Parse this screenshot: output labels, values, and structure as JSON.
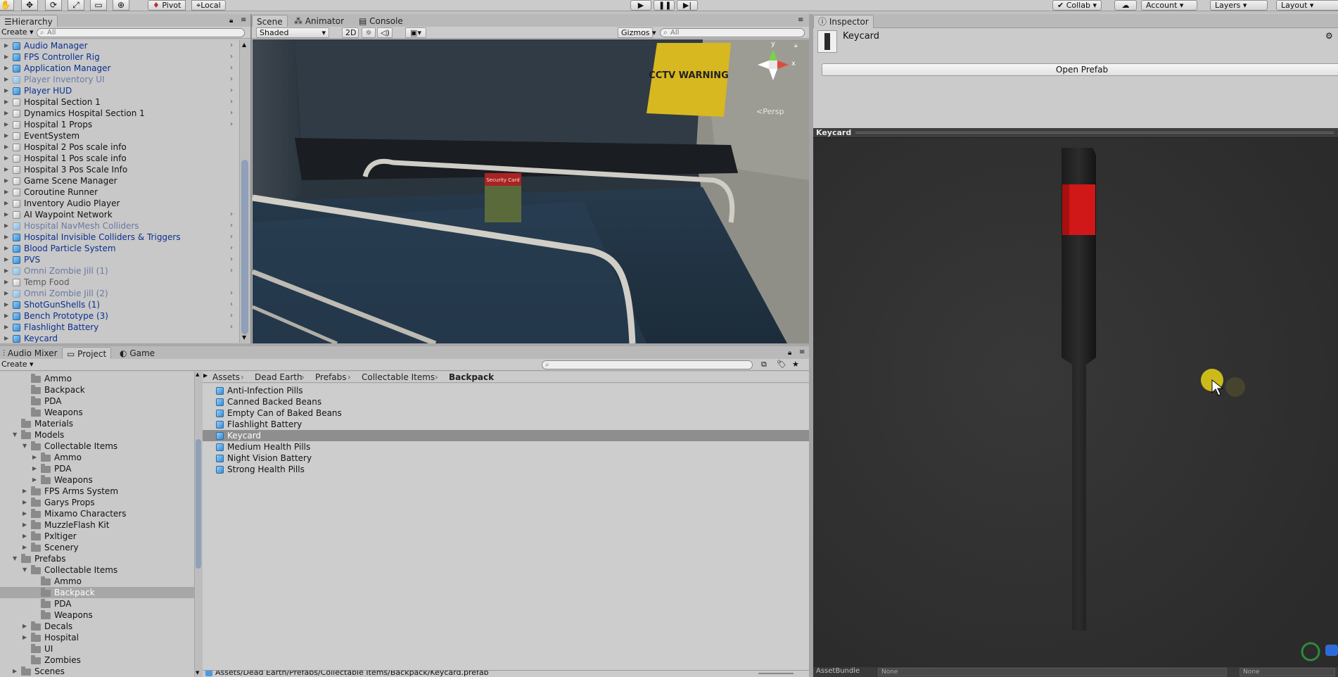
{
  "toolbar": {
    "pivot_label": "Pivot",
    "local_label": "Local",
    "collab_label": "Collab",
    "account_label": "Account",
    "layers_label": "Layers",
    "layout_label": "Layout"
  },
  "hierarchy": {
    "tab_label": "Hierarchy",
    "create_label": "Create",
    "search_placeholder": "All",
    "items": [
      {
        "label": "Audio Manager",
        "type": "prefab",
        "expand": true
      },
      {
        "label": "FPS Controller Rig",
        "type": "prefab",
        "expand": true
      },
      {
        "label": "Application Manager",
        "type": "prefab",
        "expand": true
      },
      {
        "label": "Player Inventory UI",
        "type": "off",
        "expand": true
      },
      {
        "label": "Player HUD",
        "type": "prefab",
        "expand": true
      },
      {
        "label": "Hospital Section 1",
        "type": "go",
        "expand": true
      },
      {
        "label": "Dynamics Hospital Section 1",
        "type": "go",
        "expand": true
      },
      {
        "label": "Hospital 1 Props",
        "type": "go",
        "expand": true
      },
      {
        "label": "EventSystem",
        "type": "go",
        "expand": false
      },
      {
        "label": "Hospital 2 Pos scale info",
        "type": "go",
        "expand": false
      },
      {
        "label": "Hospital 1 Pos scale info",
        "type": "go",
        "expand": false
      },
      {
        "label": "Hospital 3 Pos Scale Info",
        "type": "go",
        "expand": false
      },
      {
        "label": "Game Scene Manager",
        "type": "go",
        "expand": false
      },
      {
        "label": "Coroutine Runner",
        "type": "go",
        "expand": false
      },
      {
        "label": "Inventory Audio Player",
        "type": "go",
        "expand": false
      },
      {
        "label": "AI Waypoint Network",
        "type": "go",
        "expand": true
      },
      {
        "label": "Hospital NavMesh Colliders",
        "type": "off",
        "expand": true
      },
      {
        "label": "Hospital Invisible Colliders & Triggers",
        "type": "prefab",
        "expand": true
      },
      {
        "label": "Blood Particle System",
        "type": "prefab",
        "expand": true
      },
      {
        "label": "PVS",
        "type": "prefab",
        "expand": true
      },
      {
        "label": "Omni Zombie Jill (1)",
        "type": "off",
        "expand": true
      },
      {
        "label": "Temp Food",
        "type": "dimgo",
        "expand": false
      },
      {
        "label": "Omni Zombie Jill (2)",
        "type": "off",
        "expand": true
      },
      {
        "label": "ShotGunShells (1)",
        "type": "prefab",
        "expand": true
      },
      {
        "label": "Bench Prototype (3)",
        "type": "prefab",
        "expand": true
      },
      {
        "label": "Flashlight Battery",
        "type": "prefab",
        "expand": true
      },
      {
        "label": "Keycard",
        "type": "prefab",
        "expand": false
      }
    ]
  },
  "scene": {
    "tabs": [
      "Scene",
      "Animator",
      "Console"
    ],
    "shading_mode": "Shaded",
    "mode_2d": "2D",
    "gizmos_label": "Gizmos",
    "search_placeholder": "All",
    "persp_label": "Persp",
    "axis_y": "y",
    "axis_x": "x",
    "sign_text": "CCTV WARNING",
    "item_label": "Security Card"
  },
  "project": {
    "tabs": [
      "Audio Mixer",
      "Project",
      "Game"
    ],
    "create_label": "Create",
    "tree": [
      {
        "label": "Ammo",
        "depth": 2,
        "expand": false
      },
      {
        "label": "Backpack",
        "depth": 2,
        "expand": false
      },
      {
        "label": "PDA",
        "depth": 2,
        "expand": false
      },
      {
        "label": "Weapons",
        "depth": 2,
        "expand": false
      },
      {
        "label": "Materials",
        "depth": 1,
        "expand": false
      },
      {
        "label": "Models",
        "depth": 1,
        "expand": "open"
      },
      {
        "label": "Collectable Items",
        "depth": 2,
        "expand": "open"
      },
      {
        "label": "Ammo",
        "depth": 3,
        "expand": "closed"
      },
      {
        "label": "PDA",
        "depth": 3,
        "expand": "closed"
      },
      {
        "label": "Weapons",
        "depth": 3,
        "expand": "closed"
      },
      {
        "label": "FPS Arms System",
        "depth": 2,
        "expand": "closed"
      },
      {
        "label": "Garys Props",
        "depth": 2,
        "expand": "closed"
      },
      {
        "label": "Mixamo Characters",
        "depth": 2,
        "expand": "closed"
      },
      {
        "label": "MuzzleFlash Kit",
        "depth": 2,
        "expand": "closed"
      },
      {
        "label": "Pxltiger",
        "depth": 2,
        "expand": "closed"
      },
      {
        "label": "Scenery",
        "depth": 2,
        "expand": "closed"
      },
      {
        "label": "Prefabs",
        "depth": 1,
        "expand": "open"
      },
      {
        "label": "Collectable Items",
        "depth": 2,
        "expand": "open"
      },
      {
        "label": "Ammo",
        "depth": 3,
        "expand": false
      },
      {
        "label": "Backpack",
        "depth": 3,
        "expand": false,
        "selected": true
      },
      {
        "label": "PDA",
        "depth": 3,
        "expand": false
      },
      {
        "label": "Weapons",
        "depth": 3,
        "expand": false
      },
      {
        "label": "Decals",
        "depth": 2,
        "expand": "closed"
      },
      {
        "label": "Hospital",
        "depth": 2,
        "expand": "closed"
      },
      {
        "label": "UI",
        "depth": 2,
        "expand": false
      },
      {
        "label": "Zombies",
        "depth": 2,
        "expand": false
      },
      {
        "label": "Scenes",
        "depth": 1,
        "expand": "closed"
      }
    ],
    "breadcrumb": [
      "Assets",
      "Dead Earth",
      "Prefabs",
      "Collectable Items",
      "Backpack"
    ],
    "assets": [
      {
        "label": "Anti-Infection Pills"
      },
      {
        "label": "Canned Backed Beans"
      },
      {
        "label": "Empty Can of Baked Beans"
      },
      {
        "label": "Flashlight Battery"
      },
      {
        "label": "Keycard",
        "selected": true
      },
      {
        "label": "Medium Health Pills"
      },
      {
        "label": "Night Vision Battery"
      },
      {
        "label": "Strong Health Pills"
      }
    ],
    "path": "Assets/Dead Earth/Prefabs/Collectable Items/Backpack/Keycard.prefab"
  },
  "inspector": {
    "tab_label": "Inspector",
    "object_name": "Keycard",
    "open_prefab_label": "Open Prefab",
    "preview_title": "Keycard",
    "assetbundle_label": "AssetBundle",
    "assetbundle_value": "None",
    "assetbundle_variant": "None"
  },
  "colors": {
    "prefab_text": "#0a2f8f",
    "keycard_red": "#d01818",
    "cursor_highlight": "#e8d21a"
  }
}
